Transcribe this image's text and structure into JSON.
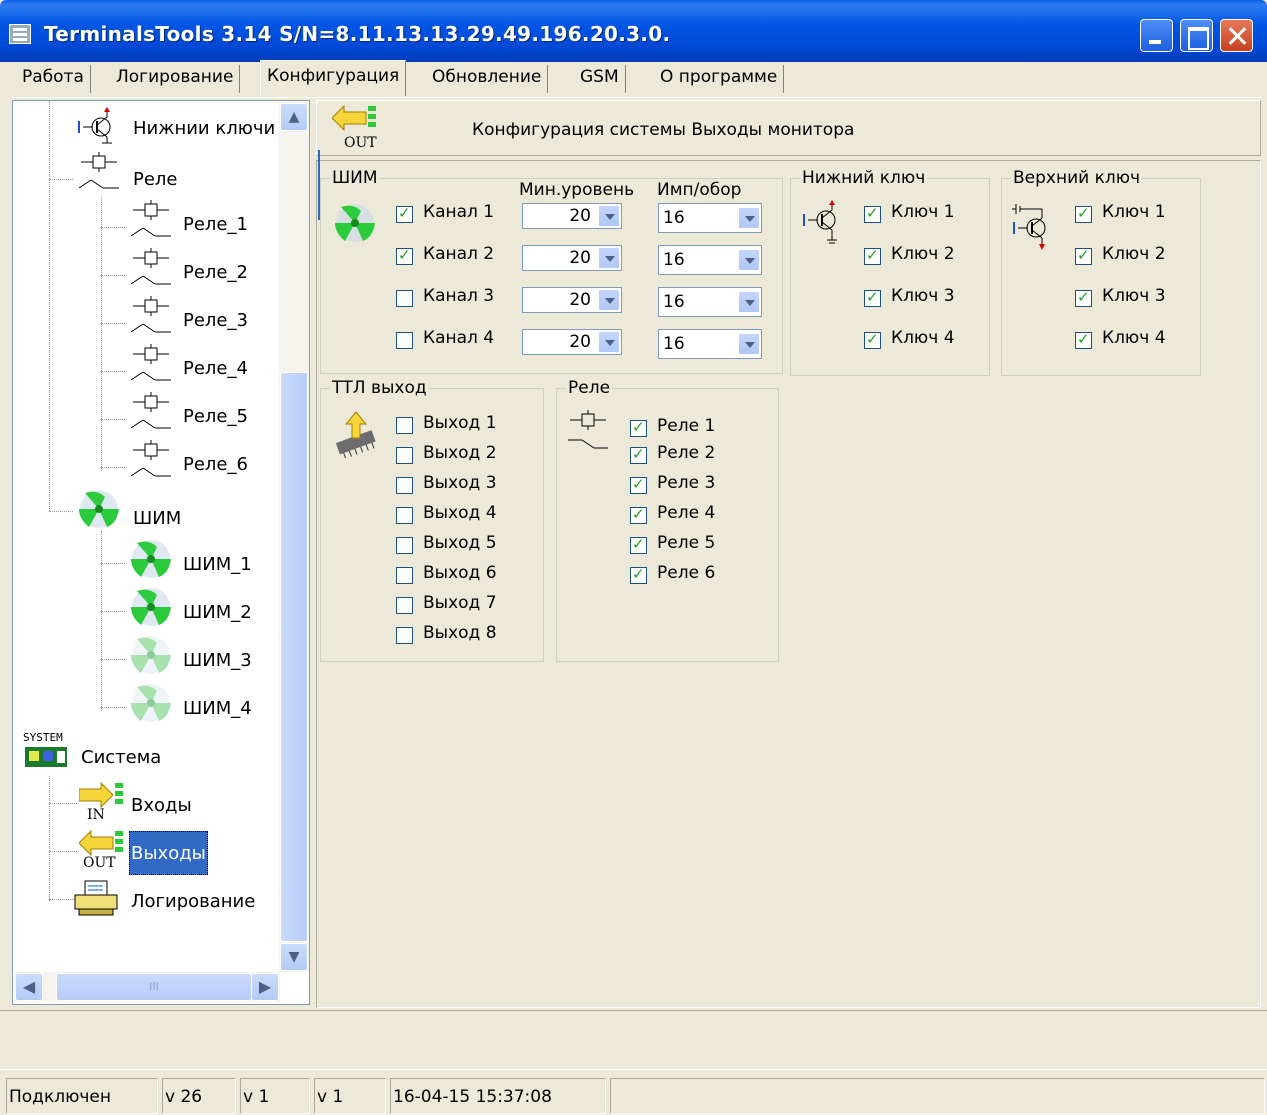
{
  "window": {
    "title": "TerminalsTools 3.14  S/N=8.11.13.13.29.49.196.20.3.0."
  },
  "tabs": [
    "Работа",
    "Логирование",
    "Конфигурация",
    "Обновление",
    "GSM",
    "О программе"
  ],
  "tree": {
    "lower_keys": "Нижнии ключи",
    "relay": "Реле",
    "relays": [
      "Реле_1",
      "Реле_2",
      "Реле_3",
      "Реле_4",
      "Реле_5",
      "Реле_6"
    ],
    "pwm": "ШИМ",
    "pwms": [
      "ШИМ_1",
      "ШИМ_2",
      "ШИМ_3",
      "ШИМ_4"
    ],
    "system_badge": "SYSTEM",
    "system": "Система",
    "inputs": "Входы",
    "inputs_badge": "IN",
    "outputs": "Выходы",
    "outputs_badge": "OUT",
    "logging": "Логирование"
  },
  "header": {
    "badge": "OUT",
    "title": "Конфигурация системы  Выходы монитора"
  },
  "pwm_group": {
    "title": "ШИМ",
    "col_min": "Мин.уровень",
    "col_imp": "Имп/обор",
    "channels": [
      {
        "label": "Канал 1",
        "checked": true,
        "min": "20",
        "imp": "16"
      },
      {
        "label": "Канал 2",
        "checked": true,
        "min": "20",
        "imp": "16"
      },
      {
        "label": "Канал 3",
        "checked": false,
        "min": "20",
        "imp": "16"
      },
      {
        "label": "Канал 4",
        "checked": false,
        "min": "20",
        "imp": "16"
      }
    ]
  },
  "lower_key_group": {
    "title": "Нижний ключ",
    "items": [
      {
        "label": "Ключ 1",
        "checked": true
      },
      {
        "label": "Ключ 2",
        "checked": true
      },
      {
        "label": "Ключ 3",
        "checked": true
      },
      {
        "label": "Ключ 4",
        "checked": true
      }
    ]
  },
  "upper_key_group": {
    "title": "Верхний ключ",
    "items": [
      {
        "label": "Ключ 1",
        "checked": true
      },
      {
        "label": "Ключ 2",
        "checked": true
      },
      {
        "label": "Ключ 3",
        "checked": true
      },
      {
        "label": "Ключ 4",
        "checked": true
      }
    ]
  },
  "ttl_group": {
    "title": "ТТЛ выход",
    "items": [
      {
        "label": "Выход 1",
        "checked": false
      },
      {
        "label": "Выход 2",
        "checked": false
      },
      {
        "label": "Выход 3",
        "checked": false
      },
      {
        "label": "Выход 4",
        "checked": false
      },
      {
        "label": "Выход 5",
        "checked": false
      },
      {
        "label": "Выход 6",
        "checked": false
      },
      {
        "label": "Выход 7",
        "checked": false
      },
      {
        "label": "Выход 8",
        "checked": false
      }
    ]
  },
  "relay_group": {
    "title": "Реле",
    "items": [
      {
        "label": "Реле 1",
        "checked": true
      },
      {
        "label": "Реле 2",
        "checked": true
      },
      {
        "label": "Реле 3",
        "checked": true
      },
      {
        "label": "Реле 4",
        "checked": true
      },
      {
        "label": "Реле 5",
        "checked": true
      },
      {
        "label": "Реле 6",
        "checked": true
      }
    ]
  },
  "status": {
    "state": "Подключен",
    "v1": "v 26",
    "v2": "v 1",
    "v3": "v 1",
    "datetime": "16-04-15 15:37:08"
  }
}
